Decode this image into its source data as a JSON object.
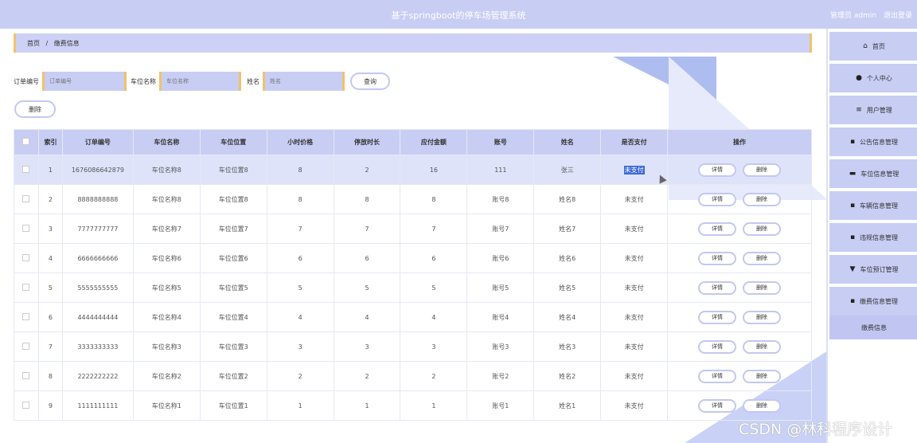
{
  "header": {
    "title": "基于springboot的停车场管理系统",
    "role": "管理员 admin",
    "logout": "退出登录"
  },
  "breadcrumb": {
    "home": "首页",
    "sep": "/",
    "current": "缴费信息"
  },
  "search": {
    "order_label": "订单编号",
    "order_placeholder": "订单编号",
    "spot_label": "车位名称",
    "spot_placeholder": "车位名称",
    "name_label": "姓名",
    "name_placeholder": "姓名",
    "query_button": "查询"
  },
  "delete_button": "删除",
  "table": {
    "headers": [
      "索引",
      "订单编号",
      "车位名称",
      "车位位置",
      "小时价格",
      "停放时长",
      "应付金额",
      "账号",
      "姓名",
      "是否支付",
      "操作"
    ],
    "rows": [
      {
        "idx": "1",
        "order": "1676086642879",
        "spot": "车位名称8",
        "loc": "车位位置8",
        "price": "8",
        "dur": "2",
        "amount": "16",
        "acct": "111",
        "name": "张三",
        "paid": "未支付"
      },
      {
        "idx": "2",
        "order": "8888888888",
        "spot": "车位名称8",
        "loc": "车位位置8",
        "price": "8",
        "dur": "8",
        "amount": "8",
        "acct": "账号8",
        "name": "姓名8",
        "paid": "未支付"
      },
      {
        "idx": "3",
        "order": "7777777777",
        "spot": "车位名称7",
        "loc": "车位位置7",
        "price": "7",
        "dur": "7",
        "amount": "7",
        "acct": "账号7",
        "name": "姓名7",
        "paid": "未支付"
      },
      {
        "idx": "4",
        "order": "6666666666",
        "spot": "车位名称6",
        "loc": "车位位置6",
        "price": "6",
        "dur": "6",
        "amount": "6",
        "acct": "账号6",
        "name": "姓名6",
        "paid": "未支付"
      },
      {
        "idx": "5",
        "order": "5555555555",
        "spot": "车位名称5",
        "loc": "车位位置5",
        "price": "5",
        "dur": "5",
        "amount": "5",
        "acct": "账号5",
        "name": "姓名5",
        "paid": "未支付"
      },
      {
        "idx": "6",
        "order": "4444444444",
        "spot": "车位名称4",
        "loc": "车位位置4",
        "price": "4",
        "dur": "4",
        "amount": "4",
        "acct": "账号4",
        "name": "姓名4",
        "paid": "未支付"
      },
      {
        "idx": "7",
        "order": "3333333333",
        "spot": "车位名称3",
        "loc": "车位位置3",
        "price": "3",
        "dur": "3",
        "amount": "3",
        "acct": "账号3",
        "name": "姓名3",
        "paid": "未支付"
      },
      {
        "idx": "8",
        "order": "2222222222",
        "spot": "车位名称2",
        "loc": "车位位置2",
        "price": "2",
        "dur": "2",
        "amount": "2",
        "acct": "账号2",
        "name": "姓名2",
        "paid": "未支付"
      },
      {
        "idx": "9",
        "order": "1111111111",
        "spot": "车位名称1",
        "loc": "车位位置1",
        "price": "1",
        "dur": "1",
        "amount": "1",
        "acct": "账号1",
        "name": "姓名1",
        "paid": "未支付"
      }
    ],
    "detail_label": "详情",
    "delete_label": "删除"
  },
  "sidebar": {
    "items": [
      {
        "label": "首页",
        "icon": "home-icon",
        "glyph": "⌂"
      },
      {
        "label": "个人中心",
        "icon": "user-icon",
        "glyph": "●"
      },
      {
        "label": "用户管理",
        "icon": "menu-icon",
        "glyph": "≡"
      },
      {
        "label": "公告信息管理",
        "icon": "grid-icon",
        "glyph": "▪"
      },
      {
        "label": "车位信息管理",
        "icon": "briefcase-icon",
        "glyph": "▬"
      },
      {
        "label": "车辆信息管理",
        "icon": "grid-icon",
        "glyph": "▪"
      },
      {
        "label": "违规信息管理",
        "icon": "grid-icon",
        "glyph": "▪"
      },
      {
        "label": "车位预订管理",
        "icon": "trophy-icon",
        "glyph": "▼"
      },
      {
        "label": "缴费信息管理",
        "icon": "grid-icon",
        "glyph": "▪"
      }
    ],
    "sub_item": "缴费信息"
  },
  "watermark": "CSDN @林科程序设计",
  "colors": {
    "accent": "#c8cdf4",
    "border_accent": "#f0c26a",
    "highlight": "#3e6ad6"
  }
}
